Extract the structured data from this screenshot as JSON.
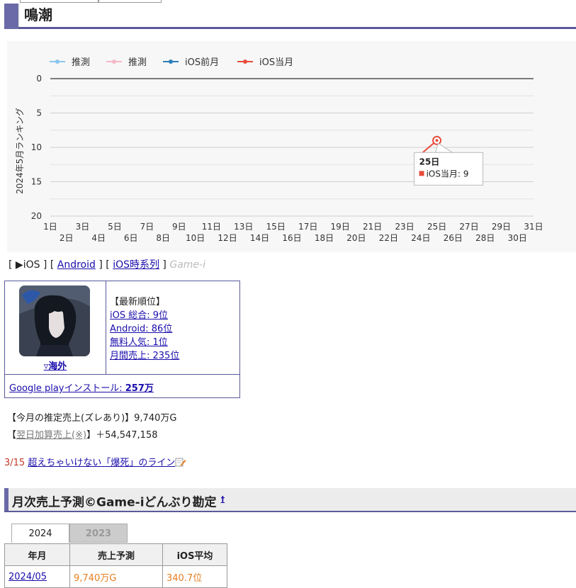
{
  "title": "鳴潮",
  "chart_data": {
    "type": "line",
    "ylabel": "2024年5月ランキング",
    "y_ticks": [
      "0",
      "5",
      "10",
      "15",
      "20"
    ],
    "ylim": [
      0,
      20
    ],
    "y_inverted": true,
    "x_categories": [
      "1日",
      "2日",
      "3日",
      "4日",
      "5日",
      "6日",
      "7日",
      "8日",
      "9日",
      "10日",
      "11日",
      "12日",
      "13日",
      "14日",
      "15日",
      "16日",
      "17日",
      "18日",
      "19日",
      "20日",
      "21日",
      "22日",
      "23日",
      "24日",
      "25日",
      "26日",
      "27日",
      "28日",
      "29日",
      "30日",
      "31日"
    ],
    "legend": [
      {
        "name": "推測",
        "color": "#8ac6f0"
      },
      {
        "name": "推測",
        "color": "#f5b8c8"
      },
      {
        "name": "iOS前月",
        "color": "#2a7fb8"
      },
      {
        "name": "iOS当月",
        "color": "#e74c3c"
      }
    ],
    "series": [
      {
        "name": "iOS当月",
        "color": "#e74c3c",
        "x": [
          24,
          25
        ],
        "y": [
          11,
          9
        ]
      }
    ],
    "tooltip": {
      "title": "25日",
      "label": "iOS当月: 9"
    },
    "grid": true
  },
  "nav": {
    "ios": "▶iOS",
    "android": "Android",
    "ios_series": "iOS時系列",
    "gamei": "Game-i"
  },
  "info": {
    "overseas": "▿海外",
    "latest_header": "【最新順位】",
    "ranks": [
      "iOS 総合: 9位",
      "Android: 86位",
      "無料人気: 1位",
      "月間売上: 235位"
    ],
    "gp_label": "Google playインストール: ",
    "gp_value": "257万"
  },
  "sales": {
    "estimate": "【今月の推定売上(ズレあり)】9,740万G",
    "next_prefix": "【",
    "next_link": "翌日加算売上(※)",
    "next_suffix": "】＋54,547,158"
  },
  "limit": {
    "ratio": "3/15",
    "text": "超えちゃいけない「爆死」のライン"
  },
  "section": {
    "title": "月次売上予測©Game-iどんぶり勘定",
    "dagger": "†"
  },
  "tabs": [
    "2024",
    "2023"
  ],
  "table": {
    "headers": [
      "年月",
      "売上予測",
      "iOS平均"
    ],
    "rows": [
      [
        "2024/05",
        "9,740万G",
        "340.7位"
      ]
    ]
  }
}
